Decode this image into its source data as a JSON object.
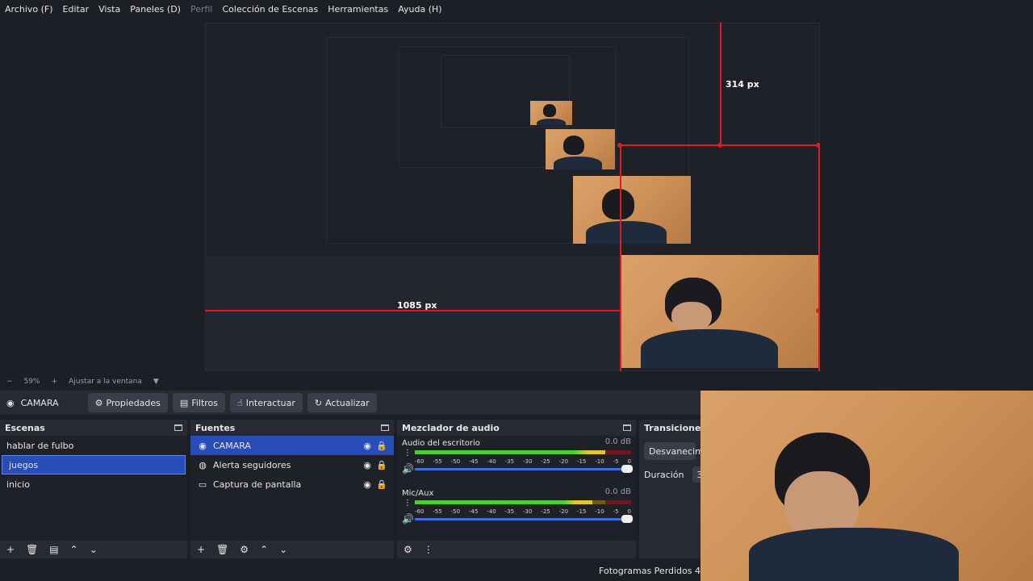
{
  "menu": {
    "items": [
      {
        "label": "Archivo (F)",
        "disabled": false
      },
      {
        "label": "Editar",
        "disabled": false
      },
      {
        "label": "Vista",
        "disabled": false
      },
      {
        "label": "Paneles (D)",
        "disabled": false
      },
      {
        "label": "Perfil",
        "disabled": true
      },
      {
        "label": "Colección de Escenas",
        "disabled": false
      },
      {
        "label": "Herramientas",
        "disabled": false
      },
      {
        "label": "Ayuda (H)",
        "disabled": false
      }
    ]
  },
  "preview": {
    "measure_top": "314 px",
    "measure_left": "1085 px"
  },
  "zoom": {
    "minus": "−",
    "level": "59%",
    "plus": "+",
    "fit_label": "Ajustar a la ventana",
    "dropdown_icon": "▼"
  },
  "context_bar": {
    "source_name": "CAMARA",
    "buttons": {
      "properties": "Propiedades",
      "filters": "Filtros",
      "interact": "Interactuar",
      "refresh": "Actualizar"
    }
  },
  "scenes": {
    "title": "Escenas",
    "items": [
      "hablar de fulbo",
      "juegos",
      "inicio"
    ],
    "selected": "juegos"
  },
  "sources": {
    "title": "Fuentes",
    "items": [
      {
        "label": "CAMARA",
        "icon": "camera-icon",
        "selected": true
      },
      {
        "label": "Alerta seguidores",
        "icon": "browser-icon",
        "selected": false
      },
      {
        "label": "Captura de pantalla",
        "icon": "display-icon",
        "selected": false
      }
    ]
  },
  "mixer": {
    "title": "Mezclador de audio",
    "ticks": [
      "-60",
      "-55",
      "-50",
      "-45",
      "-40",
      "-35",
      "-30",
      "-25",
      "-20",
      "-15",
      "-10",
      "-5",
      "0"
    ],
    "channels": [
      {
        "name": "Audio del escritorio",
        "db": "0.0 dB",
        "level": 0.88
      },
      {
        "name": "Mic/Aux",
        "db": "0.0 dB",
        "level": 0.82
      }
    ]
  },
  "transitions": {
    "title": "Transiciones",
    "selected": "Desvanecimie",
    "duration_label": "Duración",
    "duration_value": "30"
  },
  "status": {
    "dropped_frames": "Fotogramas Perdidos 4"
  },
  "colors": {
    "accent": "#284cb8",
    "guide_red": "#e01b24",
    "meter_green": "#4bd12b",
    "meter_yellow": "#e2c72a"
  }
}
